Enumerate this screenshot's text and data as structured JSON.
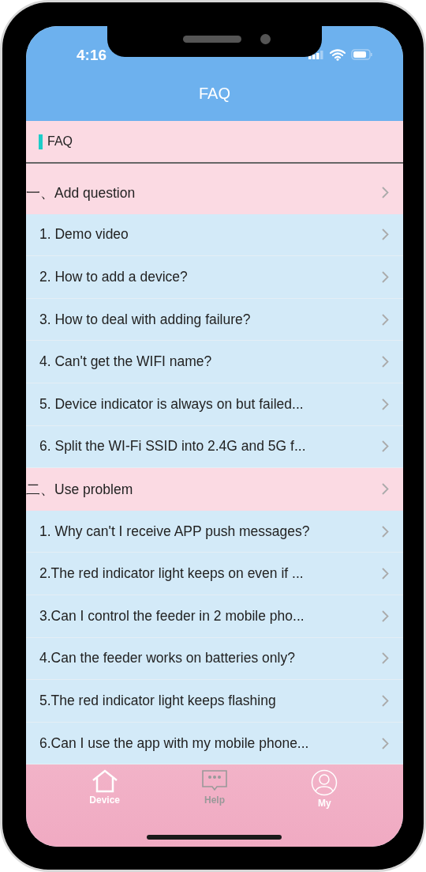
{
  "status_bar": {
    "time": "4:16"
  },
  "header": {
    "title": "FAQ"
  },
  "section_title": "FAQ",
  "list": [
    {
      "kind": "group",
      "text": "一、Add question"
    },
    {
      "kind": "item",
      "text": "1. Demo video"
    },
    {
      "kind": "item",
      "text": "2. How to add a device?"
    },
    {
      "kind": "item",
      "text": "3. How to deal with adding failure?"
    },
    {
      "kind": "item",
      "text": "4. Can't get the WIFI name?"
    },
    {
      "kind": "item",
      "text": "5. Device indicator is always on but failed..."
    },
    {
      "kind": "item",
      "text": "6. Split the WI-Fi SSID into 2.4G and 5G f..."
    },
    {
      "kind": "group",
      "text": "二、Use problem"
    },
    {
      "kind": "item",
      "text": "1. Why can't I receive APP push messages?"
    },
    {
      "kind": "item",
      "text": "2.The red indicator light keeps on even if ..."
    },
    {
      "kind": "item",
      "text": "3.Can I control the feeder in 2 mobile pho..."
    },
    {
      "kind": "item",
      "text": "4.Can the feeder works on batteries only?"
    },
    {
      "kind": "item",
      "text": "5.The red indicator light keeps flashing"
    },
    {
      "kind": "item",
      "text": "6.Can I use the app with my mobile phone..."
    }
  ],
  "tab_bar": [
    {
      "kind": "home",
      "label": "Device",
      "selected": false
    },
    {
      "kind": "chat",
      "label": "Help",
      "selected": true
    },
    {
      "kind": "person",
      "label": "My",
      "selected": false
    }
  ]
}
